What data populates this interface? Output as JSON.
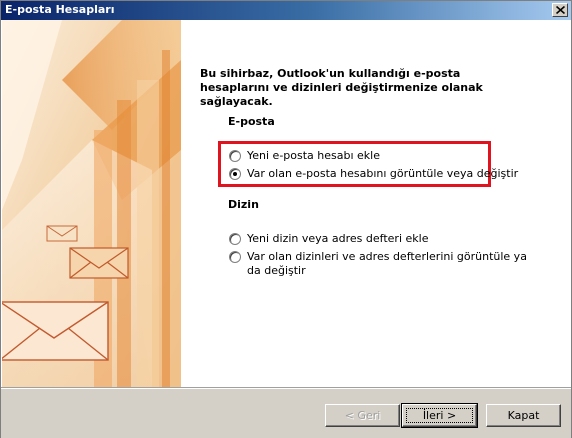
{
  "window": {
    "title": "E-posta Hesapları",
    "close_icon": "close-icon"
  },
  "intro_text": "Bu sihirbaz, Outlook'un kullandığı e-posta hesaplarını ve dizinleri değiştirmenize olanak sağlayacak.",
  "email_section": {
    "label": "E-posta",
    "options": [
      {
        "label": "Yeni e-posta hesabı ekle",
        "checked": false
      },
      {
        "label": "Var olan e-posta hesabını görüntüle veya değiştir",
        "checked": true
      }
    ]
  },
  "directory_section": {
    "label": "Dizin",
    "options": [
      {
        "label": "Yeni dizin veya adres defteri ekle",
        "checked": false
      },
      {
        "label": "Var olan dizinleri ve adres defterlerini görüntüle ya da değiştir",
        "checked": false
      }
    ]
  },
  "buttons": {
    "back": "< Geri",
    "next": "İleri >",
    "close": "Kapat"
  },
  "colors": {
    "highlight": "#e0141e",
    "title_bar": "#0a246a",
    "art_orange": "#e8a050"
  }
}
